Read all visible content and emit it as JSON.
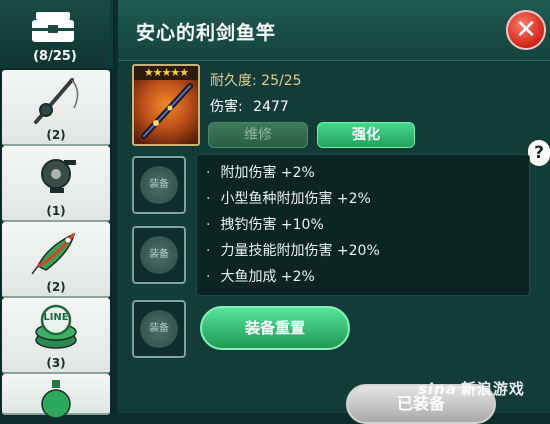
{
  "sidebar": {
    "top_tab": {
      "icon": "tackle-box-icon",
      "count": "(8/25)"
    },
    "categories": [
      {
        "icon": "rod-icon",
        "count": "(2)"
      },
      {
        "icon": "reel-icon",
        "count": "(1)"
      },
      {
        "icon": "lure-icon",
        "count": "(2)"
      },
      {
        "icon": "line-icon",
        "label": "LINE",
        "count": "(3)"
      },
      {
        "icon": "bait-bottle-icon",
        "count": ""
      }
    ]
  },
  "panel": {
    "title": "安心的利剑鱼竿",
    "close_label": "✕",
    "item": {
      "stars": "★★★★★",
      "durability_label": "耐久度: 25/25",
      "damage_label": "伤害:",
      "damage_value": "2477"
    },
    "repair_label": "维修",
    "upgrade_label": "强化",
    "help_label": "?",
    "slots": [
      {
        "label": "装备"
      },
      {
        "label": "装备"
      },
      {
        "label": "装备"
      }
    ],
    "bonuses": [
      "附加伤害 +2%",
      "小型鱼种附加伤害 +2%",
      "拽钓伤害 +10%",
      "力量技能附加伤害 +20%",
      "大鱼加成 +2%"
    ],
    "reset_label": "装备重置",
    "equipped_label": "已装备"
  },
  "watermark": {
    "brand": "sina",
    "text": "新浪游戏"
  },
  "colors": {
    "background": "#0d2d2a",
    "panel": "#133c38",
    "accent_green": "#2ec973",
    "close_red": "#d42a1d",
    "durability_gold": "#e2cf93"
  }
}
